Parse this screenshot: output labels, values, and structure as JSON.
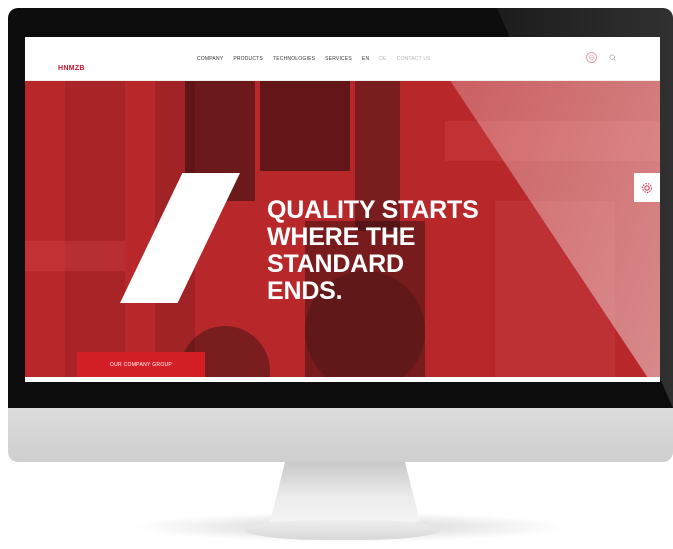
{
  "nav": {
    "logo": "HNMZB",
    "menu": [
      {
        "label": "COMPANY",
        "faded": false
      },
      {
        "label": "PRODUCTS",
        "faded": false
      },
      {
        "label": "TECHNOLOGIES",
        "faded": false
      },
      {
        "label": "SERVICES",
        "faded": false
      },
      {
        "label": "EN",
        "faded": false
      },
      {
        "label": "DE",
        "faded": true
      },
      {
        "label": "CONTACT US",
        "faded": true
      }
    ],
    "icons": {
      "lang": "globe-icon",
      "search": "search-icon"
    }
  },
  "hero": {
    "headline": [
      "QUALITY STARTS",
      "WHERE THE",
      "STANDARD",
      "ENDS."
    ],
    "cta_label": "OUR COMPANY GROUP",
    "side_tab_icon": "gear-icon"
  },
  "colors": {
    "brand_red": "#c8102e",
    "hero_red": "#bb2d2f",
    "cta_red": "#d41f26"
  }
}
